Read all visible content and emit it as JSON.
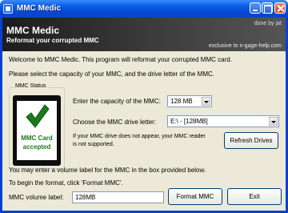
{
  "window": {
    "title": "MMC Medic"
  },
  "banner": {
    "title": "MMC Medic",
    "subtitle": "Reformat your corrupted MMC",
    "credit": "done by jat",
    "exclusive": "exclusive to n-gage-help.com"
  },
  "intro": {
    "welcome": "Welcome to MMC Medic. This program will reformat your corrupted MMC card.",
    "instruction": "Please select the capacity of your MMC, and the drive letter of the MMC."
  },
  "status": {
    "group_label": "MMC Status",
    "card_line1": "MMC Card",
    "card_line2": "accepted",
    "accent_color": "#1a7a1a"
  },
  "capacity": {
    "label": "Enter the capacity of the MMC:",
    "value": "128 MB"
  },
  "drive": {
    "label": "Choose the MMC drive letter:",
    "value": "E:\\ - [128MB]"
  },
  "drive_note": {
    "line1": "If your MMC drive does not appear, your MMC reader",
    "line2": "is not supported."
  },
  "buttons": {
    "refresh": "Refresh Drives",
    "format": "Format MMC",
    "exit": "Exit"
  },
  "volume": {
    "hint": "You may enter a volume label for the MMC in the box provided below.",
    "begin": "To begin the format, click 'Format MMC'.",
    "label": "MMC volume label:",
    "value": "128MB"
  }
}
